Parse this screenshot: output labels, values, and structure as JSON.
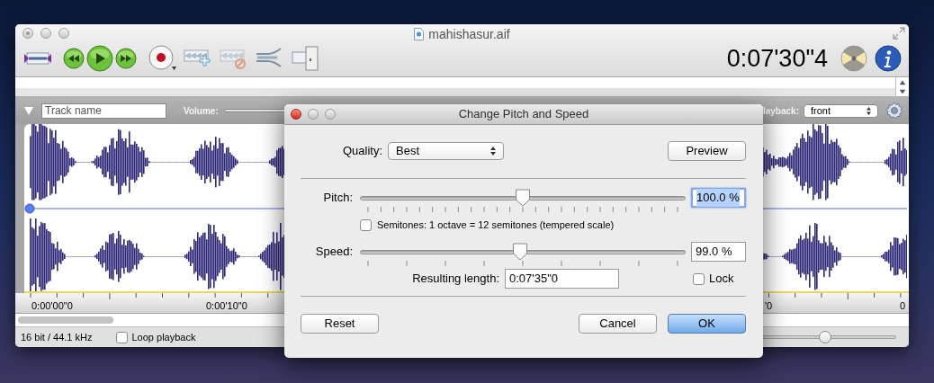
{
  "window": {
    "title": "mahishasur.aif",
    "time": "0:07'30\"4"
  },
  "track": {
    "name_field": {
      "placeholder": "Track name"
    },
    "volume_label": "Volume:",
    "playback_label": "layback:",
    "playback_value": "front"
  },
  "ruler": {
    "labels": [
      "0:00'00\"0",
      "0:00'10\"0",
      "'0",
      "0"
    ]
  },
  "status_bar": {
    "format": "16 bit / 44.1 kHz",
    "loop_playback": {
      "label": "Loop playback",
      "checked": false
    },
    "zoom": {
      "level": 0.67
    }
  },
  "dialog": {
    "title": "Change Pitch and Speed",
    "quality": {
      "label": "Quality:",
      "value": "Best"
    },
    "preview": "Preview",
    "pitch": {
      "label": "Pitch:",
      "level": 0.5,
      "value": "100.0 %",
      "focused": true
    },
    "semitones": {
      "label": "Semitones: 1 octave = 12 semitones (tempered scale)",
      "checked": false
    },
    "speed": {
      "label": "Speed:",
      "level": 0.49,
      "value": "99.0 %",
      "focused": false
    },
    "resulting_length": {
      "label": "Resulting length:",
      "value": "0:07'35\"0"
    },
    "lock": {
      "label": "Lock",
      "checked": false
    },
    "buttons": [
      {
        "label": "Reset",
        "kind": "plain"
      },
      {
        "label": "Cancel",
        "kind": "plain"
      },
      {
        "label": "OK",
        "kind": "default"
      }
    ]
  }
}
